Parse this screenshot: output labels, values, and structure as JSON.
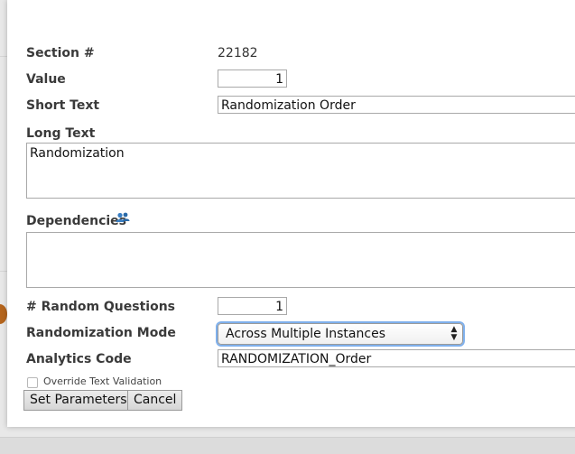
{
  "form": {
    "section": {
      "label": "Section #",
      "value": "22182"
    },
    "value": {
      "label": "Value",
      "value": "1"
    },
    "short_text": {
      "label": "Short Text",
      "value": "Randomization Order"
    },
    "long_text": {
      "label": "Long Text",
      "value": "Randomization"
    },
    "dependencies": {
      "label": "Dependencies",
      "value": ""
    },
    "random_questions": {
      "label": "# Random Questions",
      "value": "1"
    },
    "randomization_mode": {
      "label": "Randomization Mode",
      "selected": "Across Multiple Instances"
    },
    "analytics_code": {
      "label": "Analytics Code",
      "value": "RANDOMIZATION_Order"
    },
    "override": {
      "label": "Override Text Validation",
      "checked": false
    }
  },
  "buttons": {
    "set_parameters": "Set Parameters",
    "cancel": "Cancel"
  },
  "icons": {
    "dependencies": "users-icon",
    "select": "updown-arrows-icon"
  },
  "colors": {
    "focus_ring": "#7fb0ec",
    "dependency_icon": "#3a7fc4"
  }
}
